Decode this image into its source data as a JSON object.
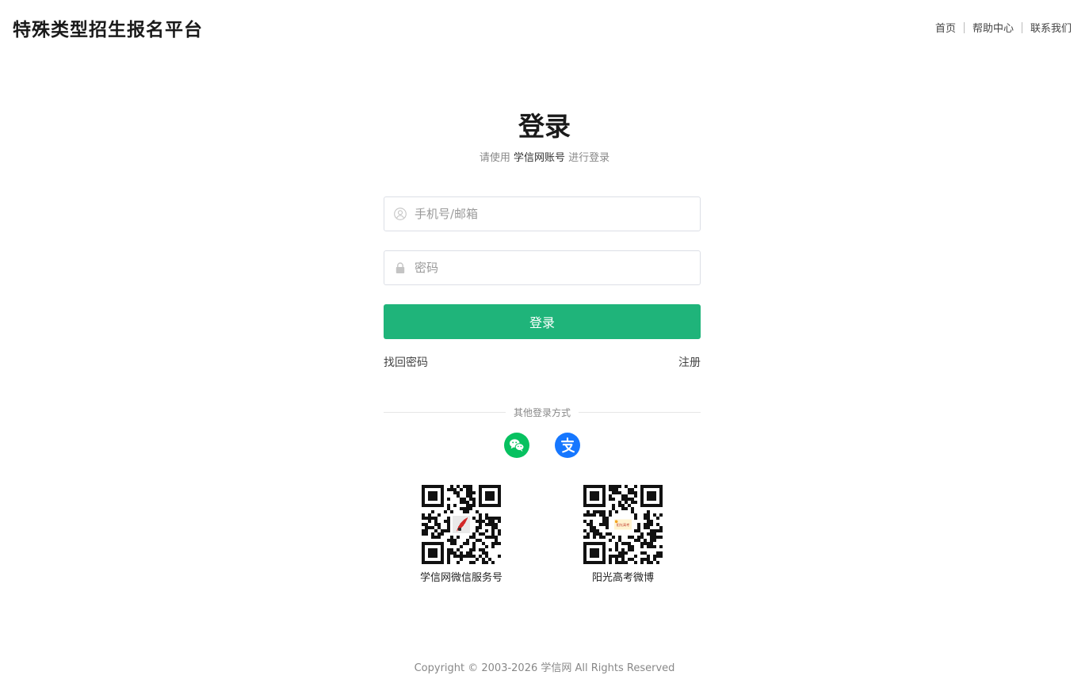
{
  "header": {
    "site_title": "特殊类型招生报名平台",
    "nav": [
      {
        "label": "首页"
      },
      {
        "label": "帮助中心"
      },
      {
        "label": "联系我们"
      }
    ]
  },
  "login": {
    "title": "登录",
    "subtitle_prefix": "请使用",
    "subtitle_account": "学信网账号",
    "subtitle_suffix": "进行登录",
    "username_placeholder": "手机号/邮箱",
    "password_placeholder": "密码",
    "submit_label": "登录",
    "forgot_label": "找回密码",
    "register_label": "注册",
    "other_methods_label": "其他登录方式"
  },
  "social": [
    {
      "icon": "wechat-icon",
      "color": "#07c160"
    },
    {
      "icon": "alipay-icon",
      "color": "#1677ff"
    }
  ],
  "qr_codes": [
    {
      "caption": "学信网微信服务号"
    },
    {
      "caption": "阳光高考微博",
      "logo_text": "阳光高考"
    }
  ],
  "footer": {
    "copyright": "Copyright © 2003-2026  学信网  All Rights Reserved"
  },
  "colors": {
    "primary": "#1fb47a",
    "wechat": "#07c160",
    "alipay": "#1677ff"
  }
}
